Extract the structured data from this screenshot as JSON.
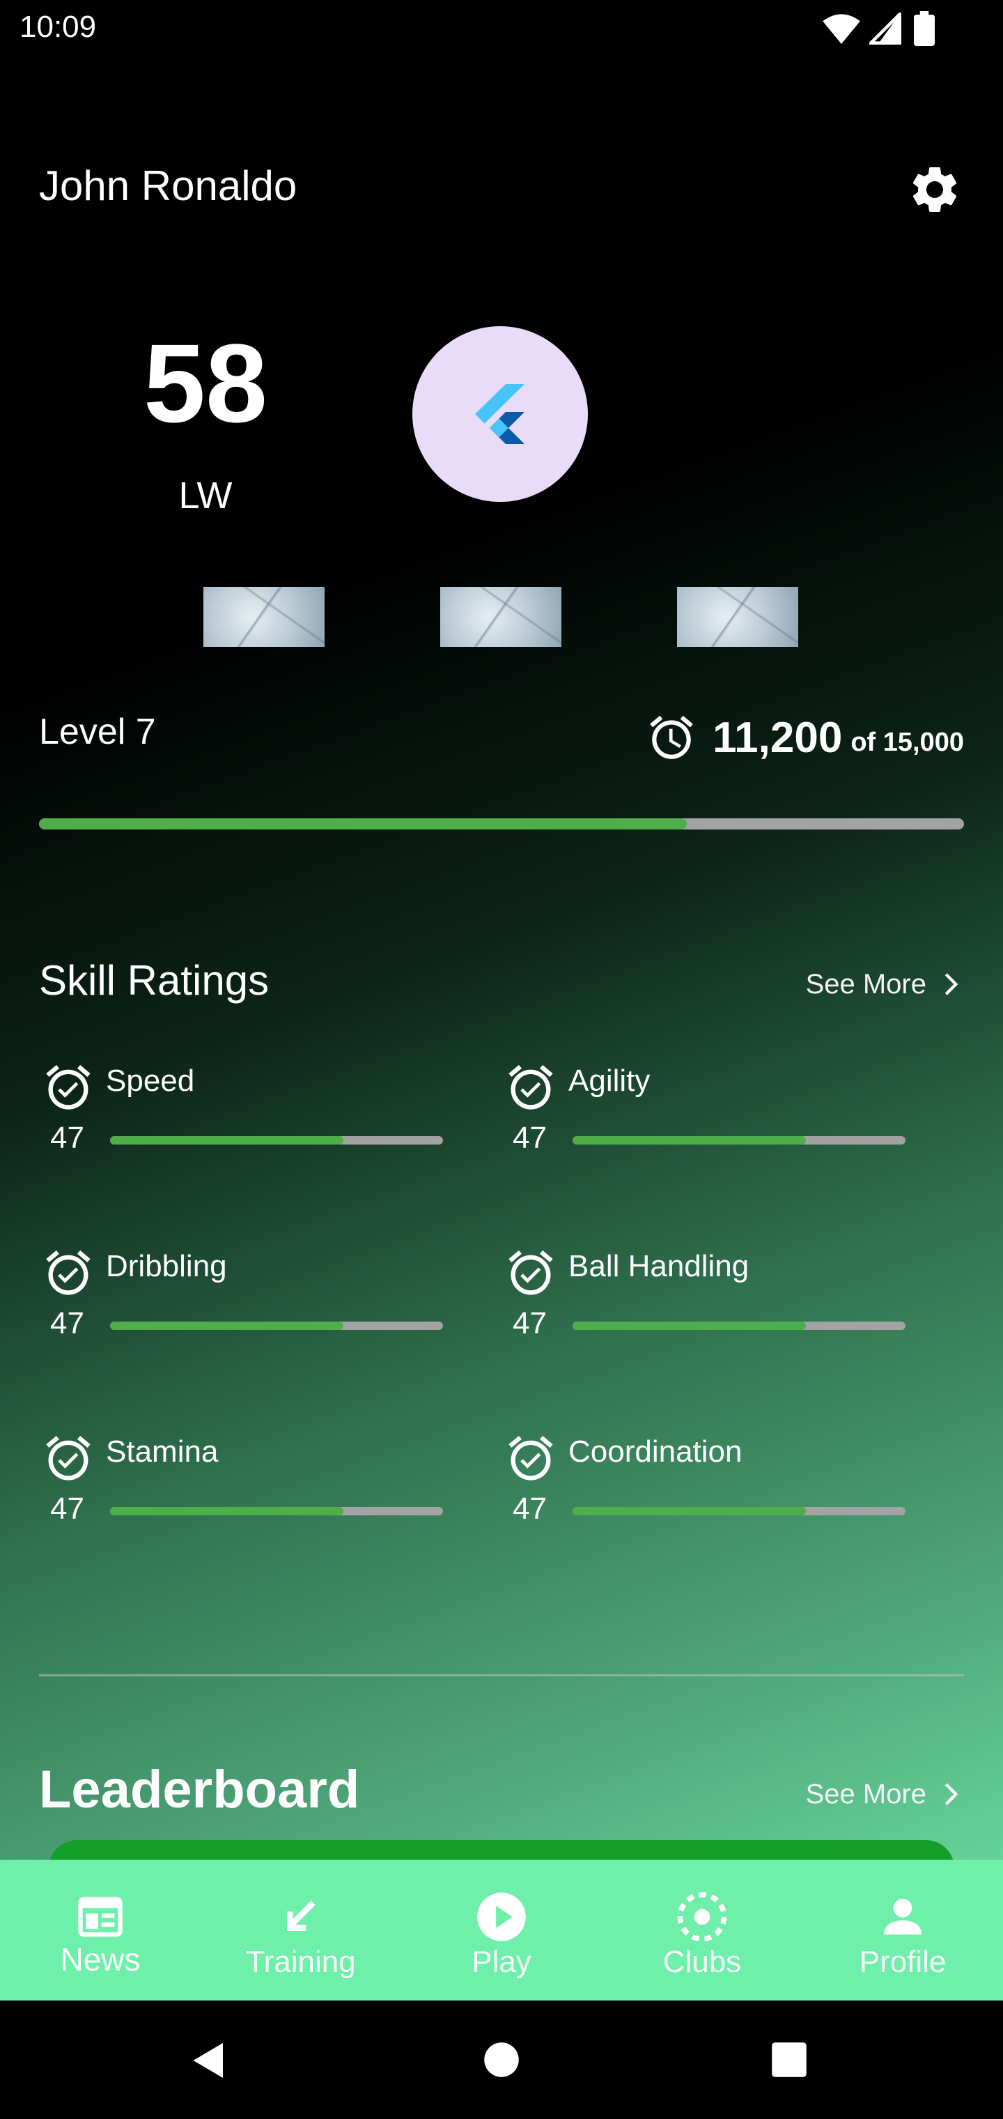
{
  "status_bar": {
    "time": "10:09"
  },
  "profile": {
    "name": "John Ronaldo",
    "rating": "58",
    "position": "LW"
  },
  "level": {
    "label": "Level 7",
    "xp_current": "11,200",
    "xp_total_text": "of 15,000",
    "progress": 0.7
  },
  "skills_section": {
    "title": "Skill Ratings",
    "see_more": "See More",
    "skills": [
      {
        "name": "Speed",
        "value": "47",
        "progress": 0.7
      },
      {
        "name": "Agility",
        "value": "47",
        "progress": 0.7
      },
      {
        "name": "Dribbling",
        "value": "47",
        "progress": 0.7
      },
      {
        "name": "Ball Handling",
        "value": "47",
        "progress": 0.7
      },
      {
        "name": "Stamina",
        "value": "47",
        "progress": 0.7
      },
      {
        "name": "Coordination",
        "value": "47",
        "progress": 0.7
      }
    ]
  },
  "leaderboard": {
    "title": "Leaderboard",
    "see_more": "See More"
  },
  "bottom_nav": {
    "items": [
      {
        "label": "News",
        "icon": "news-icon"
      },
      {
        "label": "Training",
        "icon": "training-arrow-icon"
      },
      {
        "label": "Play",
        "icon": "play-circle-icon"
      },
      {
        "label": "Clubs",
        "icon": "clubs-icon"
      },
      {
        "label": "Profile",
        "icon": "person-icon"
      }
    ],
    "active": "News"
  },
  "colors": {
    "accent_green": "#4fae4a",
    "nav_background": "#6ef0aa",
    "avatar_background": "#e9dcf8",
    "leaderboard_card": "#159e2a"
  }
}
